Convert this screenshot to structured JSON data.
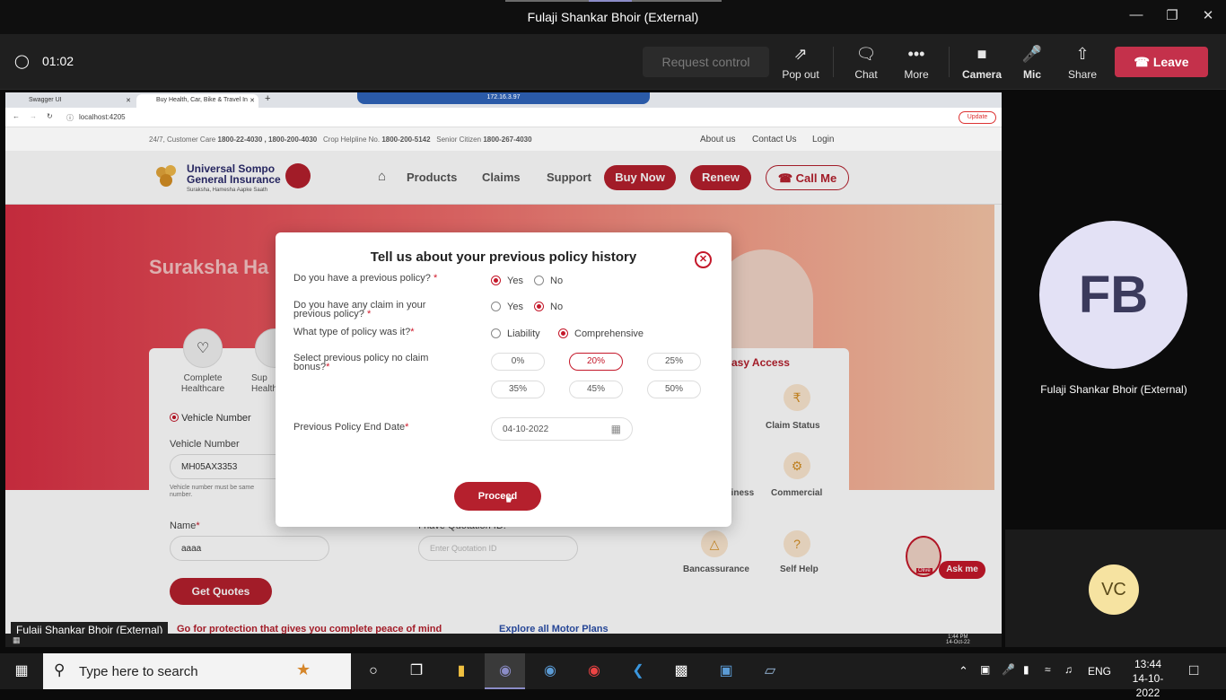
{
  "teams": {
    "window_title": "Fulaji Shankar Bhoir (External)",
    "timer": "01:02",
    "request_control": "Request control",
    "toolbar": {
      "popout": "Pop out",
      "chat": "Chat",
      "more": "More",
      "camera": "Camera",
      "mic": "Mic",
      "share": "Share",
      "leave": "Leave"
    },
    "participant_main": {
      "initials": "FB",
      "name": "Fulaji Shankar Bhoir (External)"
    },
    "participant_small": {
      "initials": "VC"
    },
    "presenter_label": "Fulaji Shankar Bhoir (External)",
    "colors": {
      "leave": "#c4314b",
      "avatar_bg": "#e3e1f5",
      "avatar_fg": "#3b3a5c",
      "vc_bg": "#f6e3a1"
    }
  },
  "browser": {
    "tabs": [
      "Swagger UI",
      "Buy Health, Car, Bike & Travel In"
    ],
    "remote_ip": "172.16.3.97",
    "url": "localhost:4205",
    "update_label": "Update"
  },
  "site": {
    "top_info": {
      "customer_care_label": "24/7, Customer Care",
      "customer_care": "1800-22-4030 , 1800-200-4030",
      "crop_label": "Crop Helpline No.",
      "crop": "1800-200-5142",
      "senior_label": "Senior Citizen",
      "senior": "1800-267-4030"
    },
    "top_links": [
      "About us",
      "Contact Us",
      "Login"
    ],
    "logo": {
      "line1": "Universal Sompo",
      "line2": "General Insurance",
      "tagline": "Suraksha, Hamesha Aapke Saath"
    },
    "nav": {
      "products": "Products",
      "claims": "Claims",
      "support": "Support"
    },
    "buttons": {
      "buy_now": "Buy Now",
      "renew": "Renew",
      "call_me": "Call Me"
    },
    "hero_title": "Suraksha Ha",
    "cards": {
      "healthcare": "Complete\nHealthcare",
      "sup": "Sup\nHealth"
    },
    "vehicle_radio": "Vehicle Number",
    "vehicle_number_label": "Vehicle Number",
    "vehicle_number_value": "MH05AX3353",
    "vehicle_hint": "Vehicle number must be same\nnumber.",
    "name_label": "Name",
    "name_value": "aaaa",
    "quotation_label": "I have Quotation ID:",
    "quotation_placeholder": "Enter Quotation ID",
    "get_quotes": "Get Quotes",
    "footer_text": "Go for protection that gives you complete peace of mind",
    "explore_link": "Explore all Motor Plans",
    "easy_access": {
      "title": "asy Access",
      "claim_status": "Claim Status",
      "business": "siness",
      "commercial": "Commercial",
      "bancassurance": "Bancassurance",
      "self_help": "Self Help"
    },
    "ask_me": "Ask me",
    "olive": "Olive"
  },
  "modal": {
    "title": "Tell us about your previous policy history",
    "q1": {
      "label": "Do you have a previous policy?",
      "options": [
        "Yes",
        "No"
      ],
      "selected": "Yes"
    },
    "q2": {
      "label": "Do you have any claim in your previous policy?",
      "options": [
        "Yes",
        "No"
      ],
      "selected": "No"
    },
    "q3": {
      "label": "What type of policy was it?",
      "options": [
        "Liability",
        "Comprehensive"
      ],
      "selected": "Comprehensive"
    },
    "q4": {
      "label": "Select previous policy no claim bonus?",
      "options": [
        "0%",
        "20%",
        "25%",
        "35%",
        "45%",
        "50%"
      ],
      "selected": "20%"
    },
    "q5": {
      "label": "Previous Policy End Date",
      "value": "04-10-2022"
    },
    "proceed": "Proceed"
  },
  "remote_taskbar": {
    "time": "1:44 PM",
    "date": "14-Oct-22"
  },
  "taskbar": {
    "search_placeholder": "Type here to search",
    "language": "ENG",
    "time": "13:44",
    "date": "14-10-2022"
  }
}
